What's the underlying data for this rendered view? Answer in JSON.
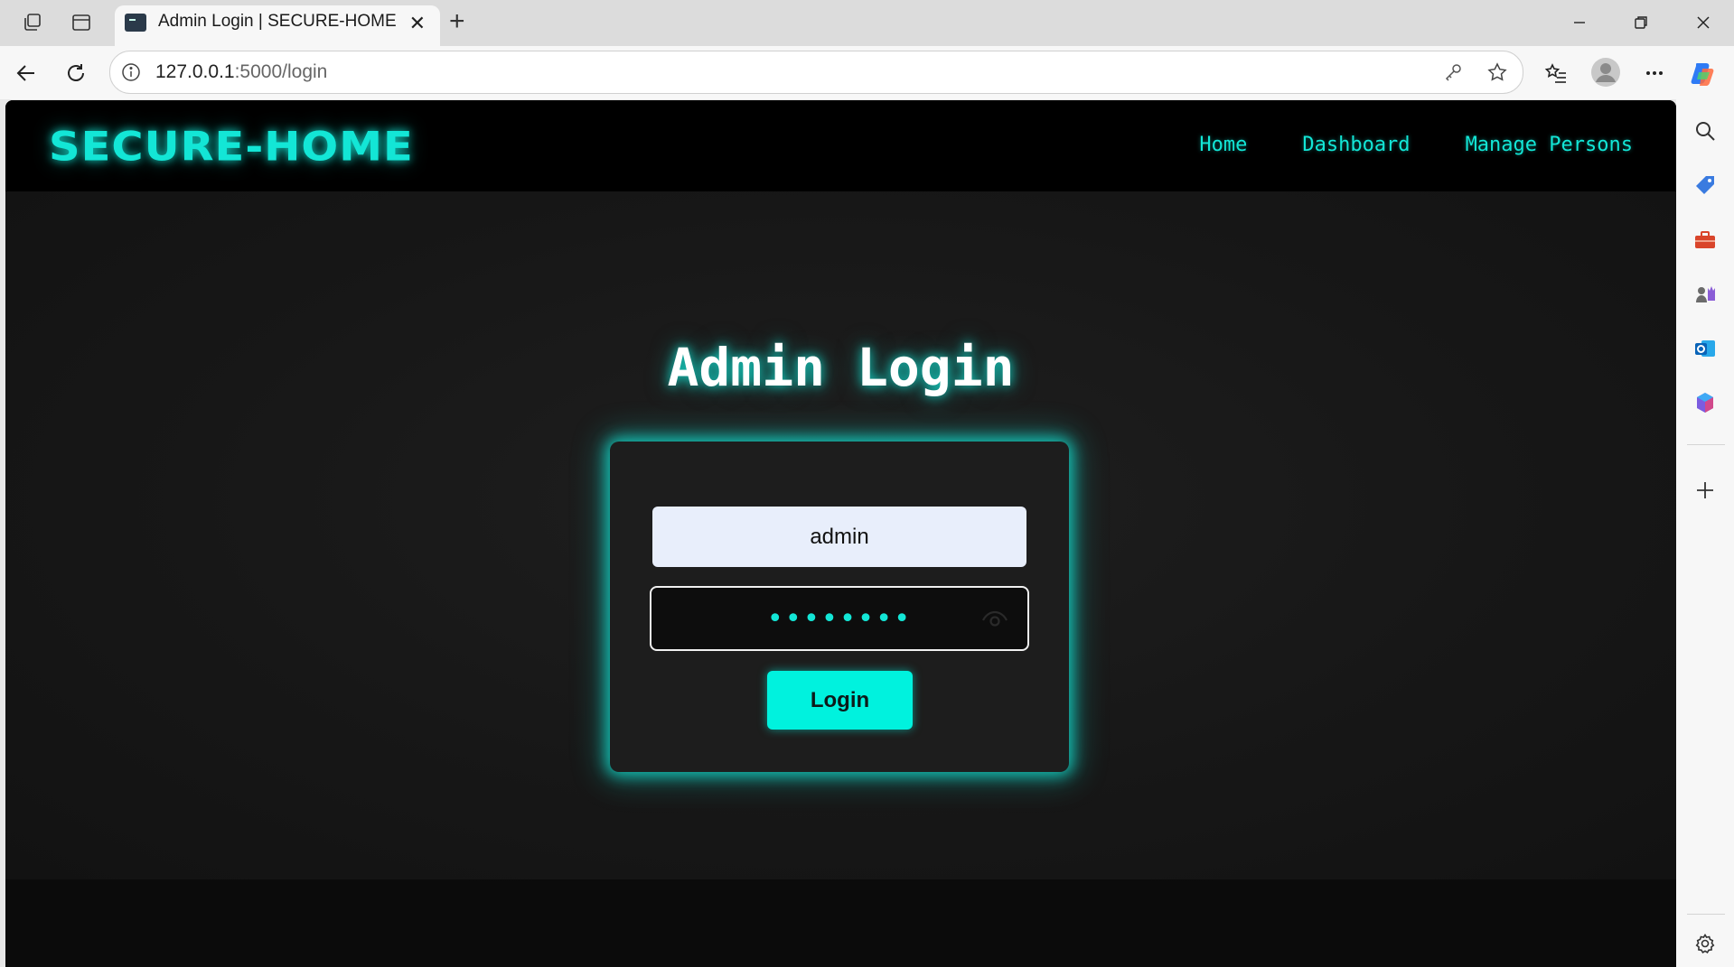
{
  "browser": {
    "tab_title": "Admin Login | SECURE-HOME",
    "url_host": "127.0.0.1",
    "url_path": ":5000/login"
  },
  "site": {
    "brand": "SECURE-HOME",
    "nav": {
      "home": "Home",
      "dashboard": "Dashboard",
      "manage_persons": "Manage Persons"
    },
    "accent_color": "#13e6d6"
  },
  "login": {
    "title": "Admin Login",
    "username_value": "admin",
    "password_mask": "••••••••",
    "button_label": "Login"
  },
  "icons": {
    "tab_actions": "tab-actions-icon",
    "vertical_tabs": "vertical-tabs-icon",
    "back": "back-arrow-icon",
    "refresh": "refresh-icon",
    "site_info": "info-icon",
    "password_key": "key-icon",
    "favorite": "star-icon",
    "favorites": "favorites-list-icon",
    "profile": "profile-avatar-icon",
    "more": "more-icon",
    "copilot": "copilot-icon",
    "sidebar_search": "search-icon",
    "shopping": "tag-icon",
    "tools": "toolbox-icon",
    "games": "games-icon",
    "outlook": "outlook-icon",
    "m365": "microsoft365-icon",
    "add": "plus-icon",
    "settings": "gear-icon",
    "show_password": "eye-icon"
  }
}
